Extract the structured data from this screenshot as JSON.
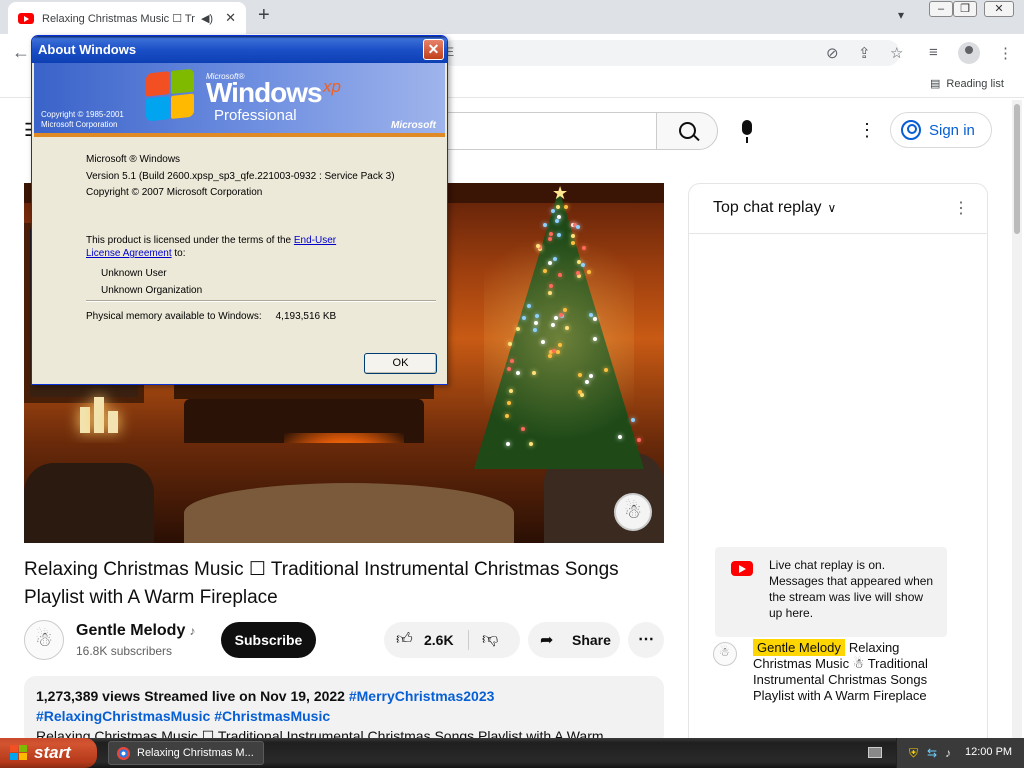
{
  "browser": {
    "tab_title": "Relaxing Christmas Music ☐ Tr",
    "tab_audio_icon": "speaker-icon",
    "new_tab_label": "+",
    "omnibox_fragment": "E",
    "reading_list_label": "Reading list"
  },
  "youtube": {
    "signin_label": "Sign in",
    "video_title": "Relaxing Christmas Music ☐ Traditional Instrumental Christmas Songs Playlist with A Warm Fireplace",
    "channel_name": "Gentle Melody",
    "subscribers": "16.8K subscribers",
    "subscribe_label": "Subscribe",
    "like_count": "2.6K",
    "share_label": "Share",
    "description": {
      "stats": "1,273,389 views  Streamed live on Nov 19, 2022",
      "tags": [
        "#MerryChristmas2023",
        "#RelaxingChristmasMusic",
        "#ChristmasMusic"
      ],
      "line2": "Relaxing Christmas Music ☐ Traditional Instrumental Christmas Songs Playlist with A Warm"
    },
    "chat": {
      "title": "Top chat replay",
      "notice": "Live chat replay is on. Messages that appeared when the stream was live will show up here.",
      "message_author": "Gentle Melody",
      "message_text": "Relaxing Christmas Music ☃ Traditional Instrumental Christmas Songs Playlist with A Warm Fireplace"
    }
  },
  "dialog": {
    "title": "About Windows",
    "close_label": "✕",
    "banner": {
      "microsoft_small": "Microsoft®",
      "windows": "Windows",
      "xp": "xp",
      "edition": "Professional",
      "copyright": "Copyright © 1985-2001",
      "copyright_corp": "Microsoft Corporation",
      "microsoft_logo": "Microsoft"
    },
    "info_line1": "Microsoft ® Windows",
    "info_line2": "Version 5.1 (Build 2600.xpsp_sp3_qfe.221003-0932 : Service Pack 3)",
    "info_line3": "Copyright © 2007 Microsoft Corporation",
    "license_prefix": "This product is licensed under the terms of the",
    "license_link_1": "End-User",
    "license_link_2": "License Agreement",
    "license_suffix": "to:",
    "user": "Unknown User",
    "organization": "Unknown Organization",
    "memory_label": "Physical memory available to Windows:",
    "memory_value": "4,193,516 KB",
    "ok_label": "OK"
  },
  "taskbar": {
    "start_label": "start",
    "task_label": "Relaxing Christmas M...",
    "clock": "12:00 PM"
  },
  "colors": {
    "youtube_red": "#ff0000",
    "link_blue": "#065fd4",
    "xp_titlebar": "#0d3fb4",
    "xp_start_green": "#b5391a"
  }
}
